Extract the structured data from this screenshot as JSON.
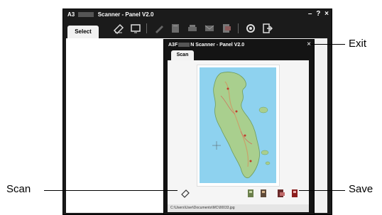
{
  "main_window": {
    "title_prefix": "A3",
    "title_suffix": "Scanner - Panel V2.0",
    "controls": [
      "–",
      "?",
      "×"
    ],
    "tab_label": "Select",
    "toolbar_icons": [
      "scanner-icon",
      "monitor-icon",
      "pen-icon",
      "book-icon",
      "printer-icon",
      "mail-icon",
      "pdf-icon",
      "settings-icon",
      "exit-icon"
    ]
  },
  "sub_window": {
    "title_prefix": "A3F",
    "title_suffix": "N Scanner - Panel V2.0",
    "close": "×",
    "tab_label": "Scan",
    "status_path": "C:\\Users\\User\\Documents\\MC\\00033.jpg"
  },
  "callouts": {
    "exit": "Exit",
    "scan": "Scan",
    "save": "Save"
  },
  "colors": {
    "window_dark": "#1b1b1b",
    "panel_light": "#f2f2f2",
    "map_sea": "#8ed2ef",
    "map_land": "#a9cf8e"
  }
}
